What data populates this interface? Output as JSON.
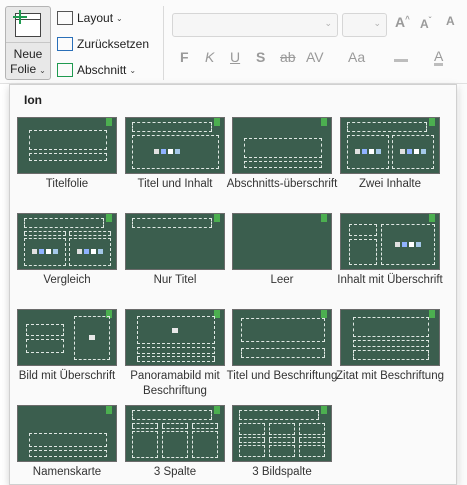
{
  "ribbon": {
    "new_slide_line1": "Neue",
    "new_slide_line2": "Folie",
    "new_slide_caret": "⌄",
    "layout_label": "Layout",
    "reset_label": "Zurücksetzen",
    "section_label": "Abschnitt",
    "font_buttons": [
      "F",
      "K",
      "U",
      "S",
      "ab",
      "AV",
      "Aa",
      "A"
    ]
  },
  "panel": {
    "theme_name": "Ion",
    "layouts": [
      "Titelfolie",
      "Titel und Inhalt",
      "Abschnitts-überschrift",
      "Zwei Inhalte",
      "Vergleich",
      "Nur Titel",
      "Leer",
      "Inhalt mit Überschrift",
      "Bild mit Überschrift",
      "Panoramabild mit Beschriftung",
      "Titel und Beschriftung",
      "Zitat mit Beschriftung",
      "Namenskarte",
      "3 Spalte",
      "3 Bildspalte"
    ]
  },
  "colors": {
    "thumb_bg": "#3b5e4e",
    "accent_green": "#4caf50"
  }
}
